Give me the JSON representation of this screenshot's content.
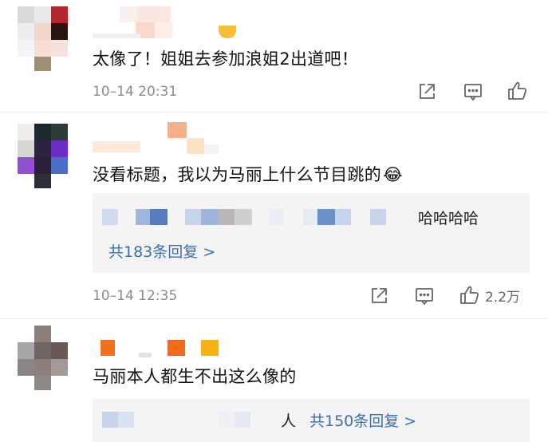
{
  "comments": [
    {
      "text": "太像了！姐姐去参加浪姐2出道吧！",
      "time": "10–14 20:31",
      "like_count": ""
    },
    {
      "text": "没看标题，我以为马丽上什么节目跳的",
      "emoji": "😂",
      "time": "10–14 12:35",
      "like_count": "2.2万",
      "reply_preview_tail": "哈哈哈哈",
      "reply_link": "共183条回复 >"
    },
    {
      "text": "马丽本人都生不出这么像的",
      "reply_preview_tail": "人",
      "reply_link": "共150条回复 >"
    }
  ],
  "icons": {
    "share": "share-icon",
    "comment": "comment-icon",
    "like": "thumbs-up-icon"
  }
}
